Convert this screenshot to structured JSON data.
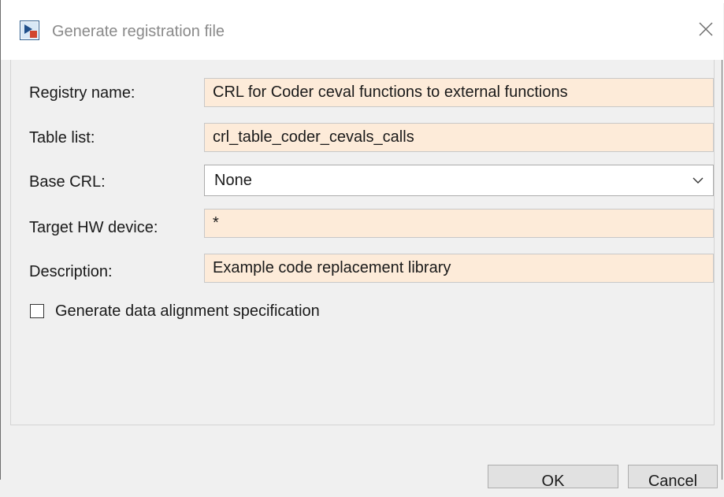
{
  "window": {
    "title": "Generate registration file",
    "close_icon": "close-icon",
    "app_icon": "matlab-dialog-icon"
  },
  "form": {
    "registry_name": {
      "label": "Registry name:",
      "value": "CRL for Coder ceval functions to external functions"
    },
    "table_list": {
      "label": "Table list:",
      "value": "crl_table_coder_cevals_calls"
    },
    "base_crl": {
      "label": "Base CRL:",
      "value": "None",
      "icon": "chevron-down-icon"
    },
    "target_hw_device": {
      "label": "Target HW device:",
      "value": "*"
    },
    "description": {
      "label": "Description:",
      "value": "Example code replacement library"
    },
    "data_alignment": {
      "label": "Generate data alignment specification",
      "checked": false
    }
  },
  "buttons": {
    "ok": "OK",
    "cancel": "Cancel"
  },
  "colors": {
    "field_background": "#fdebd9",
    "window_background": "#f0f0f0"
  }
}
